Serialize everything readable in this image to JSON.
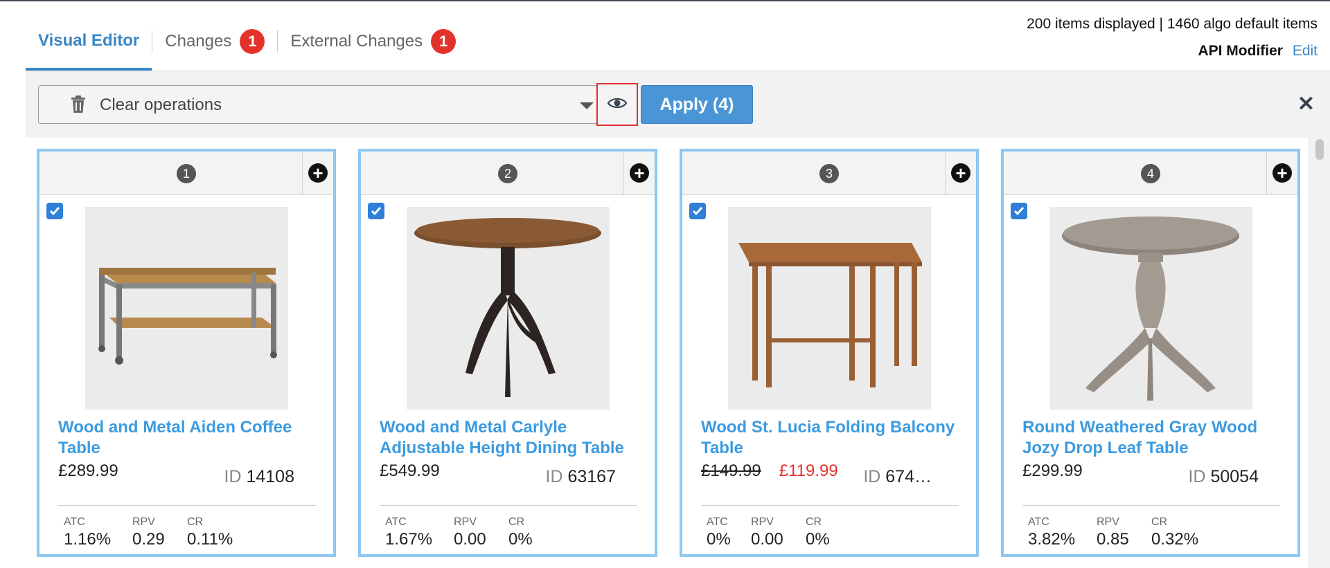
{
  "tabs": [
    {
      "label": "Visual Editor",
      "active": true
    },
    {
      "label": "Changes",
      "badge": "1"
    },
    {
      "label": "External Changes",
      "badge": "1"
    }
  ],
  "header": {
    "counts": "200 items displayed | 1460 algo default items",
    "api_label": "API Modifier",
    "api_edit": "Edit"
  },
  "toolbar": {
    "clear_label": "Clear operations",
    "apply_label": "Apply (4)",
    "close_glyph": "✕"
  },
  "cards": [
    {
      "position": "1",
      "title": "Wood and Metal Aiden Coffee Table",
      "price": "£289.99",
      "old_price": "",
      "id_label": "ID",
      "id": "14108",
      "metrics": [
        {
          "label": "ATC",
          "value": "1.16%"
        },
        {
          "label": "RPV",
          "value": "0.29"
        },
        {
          "label": "CR",
          "value": "0.11%"
        }
      ]
    },
    {
      "position": "2",
      "title": "Wood and Metal Carlyle Adjustable Height Dining Table",
      "price": "£549.99",
      "old_price": "",
      "id_label": "ID",
      "id": "63167",
      "metrics": [
        {
          "label": "ATC",
          "value": "1.67%"
        },
        {
          "label": "RPV",
          "value": "0.00"
        },
        {
          "label": "CR",
          "value": "0%"
        }
      ]
    },
    {
      "position": "3",
      "title": "Wood St. Lucia Folding Balcony Table",
      "price": "£119.99",
      "old_price": "£149.99",
      "id_label": "ID",
      "id": "674…",
      "metrics": [
        {
          "label": "ATC",
          "value": "0%"
        },
        {
          "label": "RPV",
          "value": "0.00"
        },
        {
          "label": "CR",
          "value": "0%"
        }
      ]
    },
    {
      "position": "4",
      "title": "Round Weathered Gray Wood Jozy Drop Leaf Table",
      "price": "£299.99",
      "old_price": "",
      "id_label": "ID",
      "id": "50054",
      "metrics": [
        {
          "label": "ATC",
          "value": "3.82%"
        },
        {
          "label": "RPV",
          "value": "0.85"
        },
        {
          "label": "CR",
          "value": "0.32%"
        }
      ]
    }
  ],
  "colors": {
    "accent": "#3a86c6",
    "badge": "#e3322b",
    "link": "#3c9be0",
    "card_border": "#8ec8f0",
    "apply": "#4a95d6"
  }
}
